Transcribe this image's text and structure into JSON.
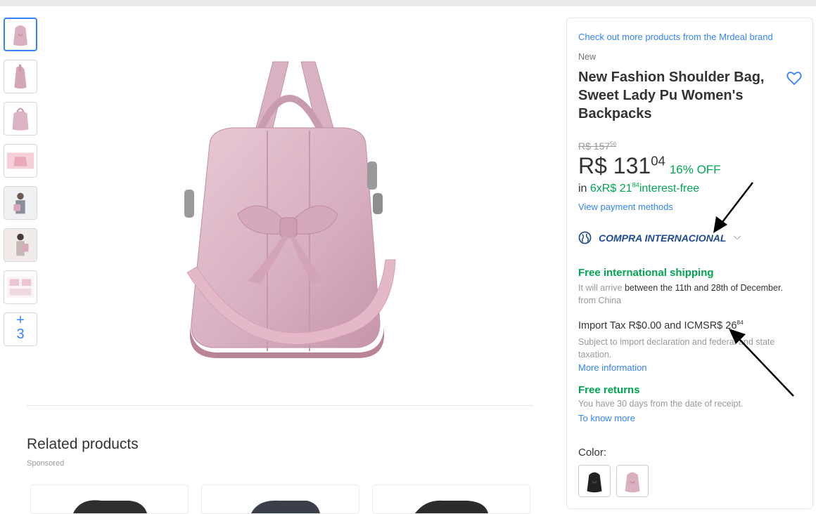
{
  "product": {
    "brand_link": "Check out more products from the Mrdeal brand",
    "condition": "New",
    "title": "New Fashion Shoulder Bag, Sweet Lady Pu Women's Backpacks",
    "old_price": "R$ 157",
    "old_price_cents": "56",
    "price": "R$ 131",
    "price_cents": "04",
    "discount": "16% OFF",
    "installments_prefix": "in ",
    "installments_value": "6xR$ 21",
    "installments_cents": "84",
    "installments_suffix": "interest-free",
    "payment_link": "View payment methods"
  },
  "international": {
    "label": "COMPRA INTERNACIONAL",
    "shipping_title": "Free international shipping",
    "arrival_prefix": "It will arrive ",
    "arrival_range": "between the 11th and 28th of December.",
    "arrival_origin": " from China",
    "tax_text": "Import Tax R$0.00 and ICMSR$ 26",
    "tax_cents": "84",
    "tax_subtext": "Subject to import declaration and federal and state taxation.",
    "more_info_link": "More information"
  },
  "returns": {
    "title": "Free returns",
    "description": "You have 30 days from the date of receipt.",
    "link": "To know more"
  },
  "color": {
    "label": "Color:",
    "options": [
      "black",
      "pink"
    ]
  },
  "gallery": {
    "more_plus": "+",
    "more_count": "3"
  },
  "related": {
    "title": "Related products",
    "sponsored": "Sponsored"
  },
  "colors": {
    "accent": "#3483fa",
    "green": "#00a650",
    "intl_blue": "#1f4b91",
    "bag_pink": "#d9b0c2"
  }
}
